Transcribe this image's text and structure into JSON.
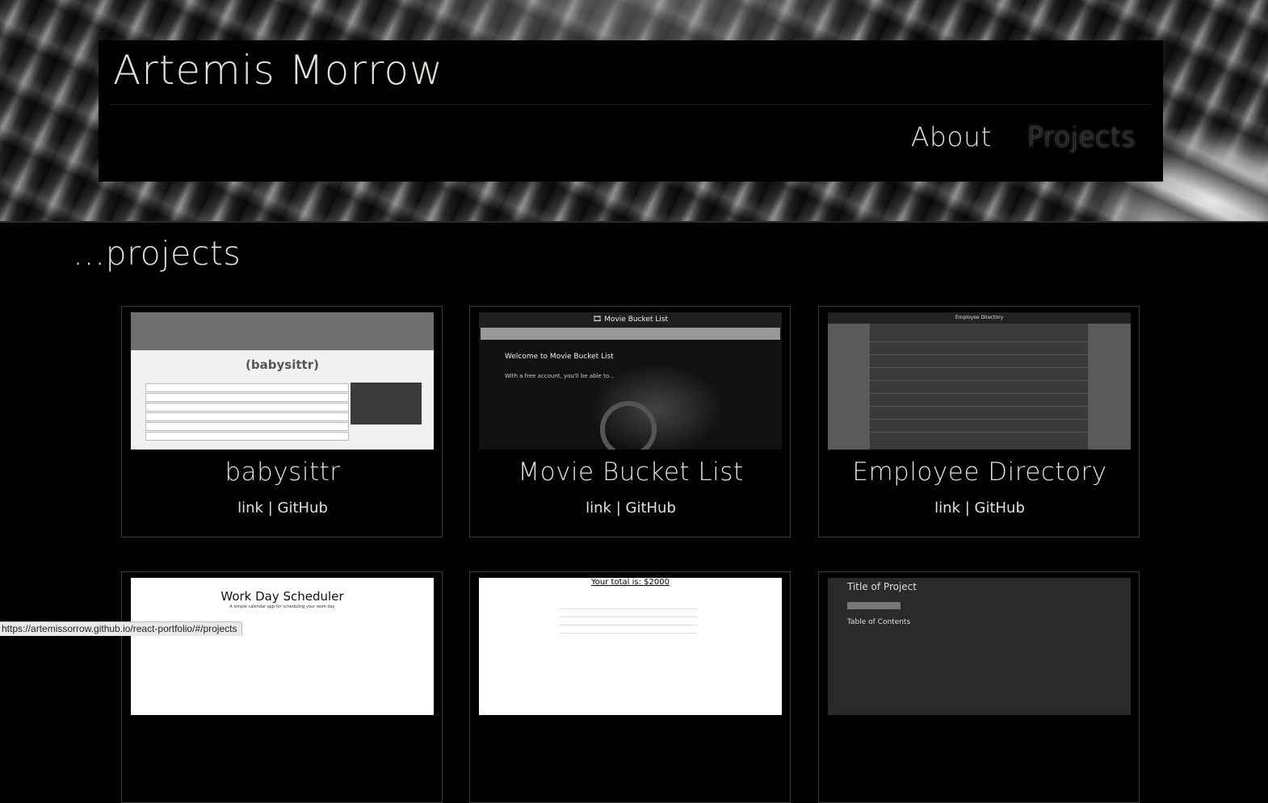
{
  "header": {
    "brand": "Artemis Morrow",
    "nav": [
      {
        "label": "About",
        "active": false
      },
      {
        "label": "Projects",
        "active": true
      }
    ]
  },
  "main": {
    "section_title": "...projects",
    "projects": [
      {
        "title": "babysittr",
        "link_label": "link",
        "separator": "|",
        "github_label": "GitHub",
        "thumb": {
          "heading": "(babysittr)"
        }
      },
      {
        "title": "Movie Bucket List",
        "link_label": "link",
        "separator": "|",
        "github_label": "GitHub",
        "thumb": {
          "heading": "🎞 Movie Bucket List",
          "welcome": "Welcome to Movie Bucket List",
          "tagline": "With a free account, you'll be able to..."
        }
      },
      {
        "title": "Employee Directory",
        "link_label": "link",
        "separator": "|",
        "github_label": "GitHub",
        "thumb": {
          "heading": "Employee Directory"
        }
      },
      {
        "title": "",
        "thumb": {
          "heading": "Work Day Scheduler",
          "subheading": "A simple calendar app for scheduling your work day"
        }
      },
      {
        "title": "",
        "thumb": {
          "heading": "Your total is: $2000"
        }
      },
      {
        "title": "",
        "thumb": {
          "heading": "Title of Project",
          "toc": "Table of Contents"
        }
      }
    ]
  },
  "status_bar": {
    "url": "https://artemissorrow.github.io/react-portfolio/#/projects"
  }
}
